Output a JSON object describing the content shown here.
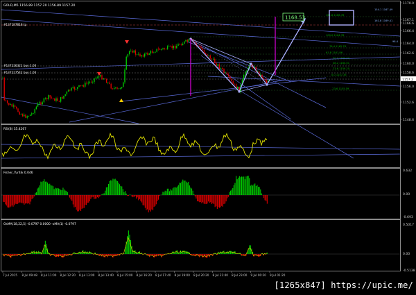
{
  "window": {
    "title": "GOLD,M5  1156.89 1157.20 1156.89 1157.20",
    "orders": [
      "#137187818 tp",
      "#137216321 buy 1.00",
      "#137217542 buy 1.00"
    ]
  },
  "colors": {
    "background": "#000000",
    "bull": "#00cc00",
    "bear": "#dd0000",
    "rsi": "#e8e800",
    "trend": "#5a6ad8",
    "fibo": "#00aa00",
    "pattern": "#aab0ff",
    "marker": "#cc00cc",
    "label": "#ffffff"
  },
  "price_scale": {
    "labels": [
      "1170.0",
      "1167.1",
      "1166.6",
      "1166.4",
      "1164.0",
      "1162.6",
      "1160.0",
      "1158.6",
      "1157.2",
      "1156.0",
      "1152.6",
      "1148.6"
    ],
    "current": "1157.2"
  },
  "main_chart": {
    "target_label": "1168.53",
    "fibo_levels": [
      "161.8 1166.78",
      "100.0 1164.78",
      "76.4 1162.78",
      "61.8 1161.86",
      "50.0 1160.93",
      "38.2 1160.01",
      "23.6 1159.20",
      "0.0 1157.35",
      "-23.6 1155.59"
    ],
    "right_labels": [
      "161.8 1169.41",
      "154.1 1167.49",
      "98.4"
    ]
  },
  "rsi": {
    "label": "RSI(8) 35.4267",
    "scale": [
      "",
      ""
    ]
  },
  "fisher": {
    "label": "Fisher_Yur4ik 0.046",
    "scale": [
      "0.632",
      "0.00",
      "-0.693"
    ]
  },
  "osma": {
    "label": "OsMA(18,22,5) -0.0797 0.0000 -xMA(1) -0.0797",
    "scale": [
      "0.5017",
      "0.00",
      "-0.5138"
    ]
  },
  "time_axis": [
    "7 Jul 2015",
    "8 Jul 09:48",
    "8 Jul 11:00",
    "8 Jul 12:20",
    "8 Jul 13:00",
    "8 Jul 13:40",
    "8 Jul 15:00",
    "8 Jul 16:20",
    "8 Jul 17:40",
    "8 Jul 19:00",
    "8 Jul 20:20",
    "8 Jul 21:40",
    "8 Jul 23:00",
    "9 Jul 00:20",
    "9 Jul 01:20"
  ],
  "caption": "[1265x847] https://upic.me/"
}
